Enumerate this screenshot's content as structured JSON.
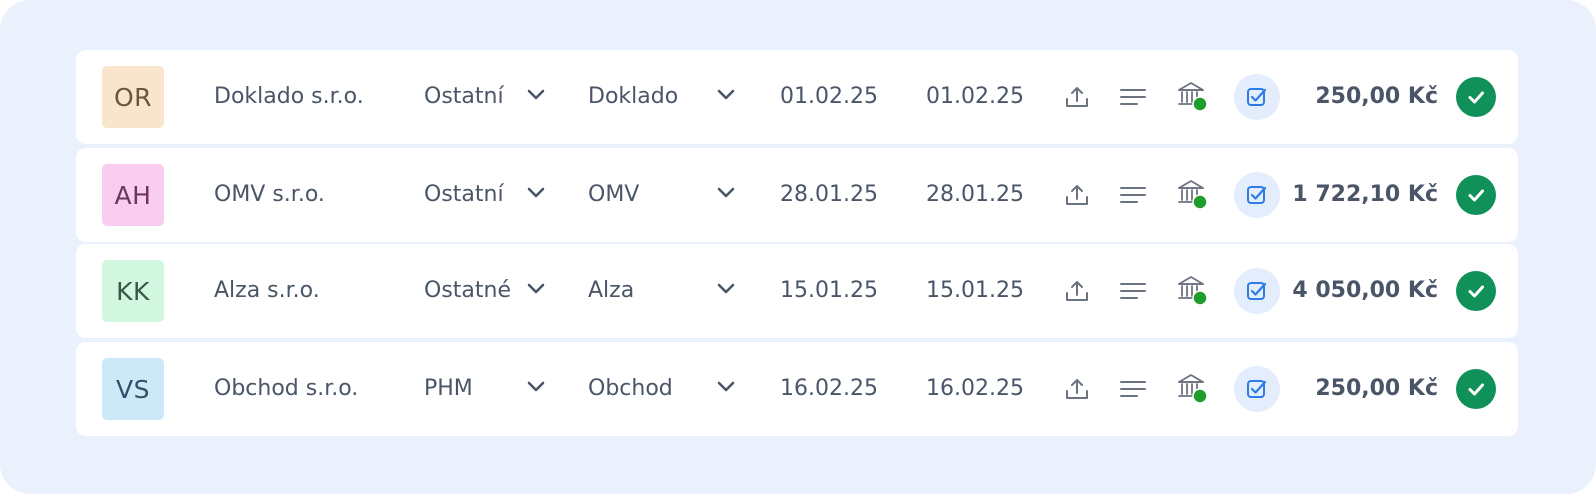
{
  "rows": [
    {
      "initials": "OR",
      "avatar_bg": "#f8e5cc",
      "avatar_fg": "#6b5639",
      "company": "Doklado s.r.o.",
      "category": "Ostatní",
      "supplier": "Doklado",
      "date_issued": "01.02.25",
      "date_due": "01.02.25",
      "amount": "250,00 Kč"
    },
    {
      "initials": "AH",
      "avatar_bg": "#f8cdef",
      "avatar_fg": "#6b3560",
      "company": "OMV s.r.o.",
      "category": "Ostatní",
      "supplier": "OMV",
      "date_issued": "28.01.25",
      "date_due": "28.01.25",
      "amount": "1 722,10 Kč"
    },
    {
      "initials": "KK",
      "avatar_bg": "#d2f7e1",
      "avatar_fg": "#355a44",
      "company": "Alza s.r.o.",
      "category": "Ostatné",
      "supplier": "Alza",
      "date_issued": "15.01.25",
      "date_due": "15.01.25",
      "amount": "4 050,00 Kč"
    },
    {
      "initials": "VS",
      "avatar_bg": "#cde9f8",
      "avatar_fg": "#34506a",
      "company": "Obchod s.r.o.",
      "category": "PHM",
      "supplier": "Obchod",
      "date_issued": "16.02.25",
      "date_due": "16.02.25",
      "amount": "250,00 Kč"
    }
  ],
  "icons": {
    "chevron": "chevron-down-icon",
    "upload": "upload-icon",
    "notes": "notes-icon",
    "bank": "bank-icon",
    "checkbox": "checkbox-icon",
    "approved": "check-circle-icon"
  },
  "colors": {
    "panel_bg": "#eaf1fd",
    "status_dot": "#1f9d2a",
    "approved": "#10915a",
    "checkbox_accent": "#2f7be8"
  }
}
